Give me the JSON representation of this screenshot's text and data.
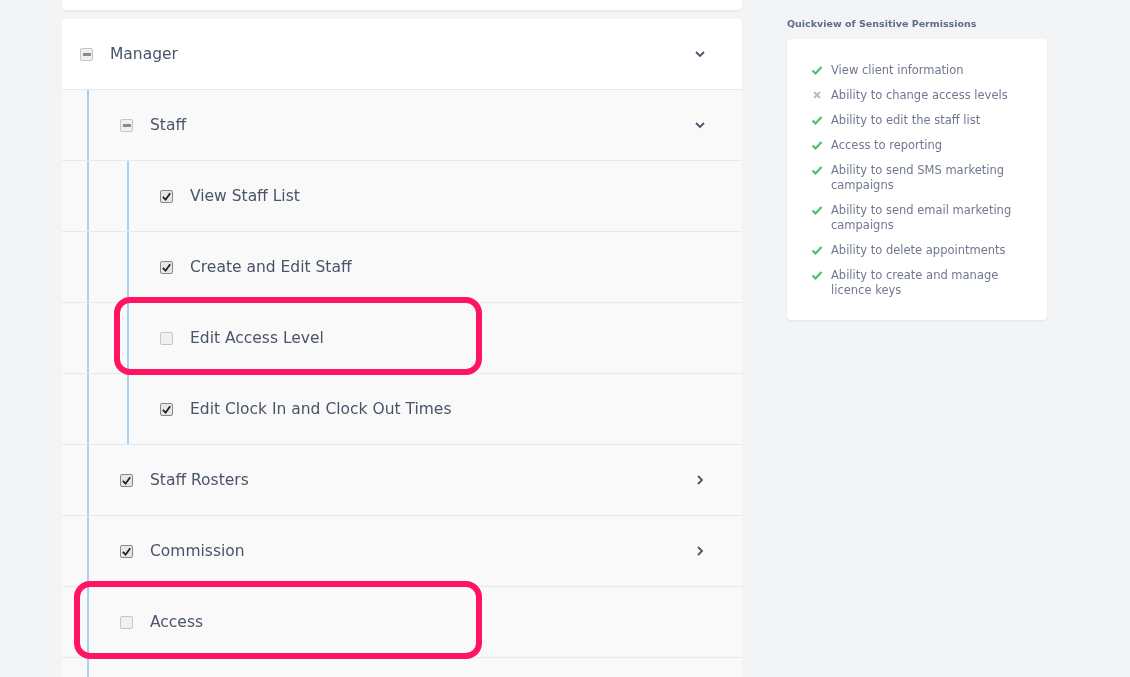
{
  "permissions": [
    {
      "label": "Manager",
      "checked": false,
      "indeterminate": true,
      "expanded": true,
      "highlighted": false,
      "children": [
        {
          "label": "Staff",
          "checked": false,
          "indeterminate": true,
          "expanded": true,
          "highlighted": false,
          "children": [
            {
              "label": "View Staff List",
              "checked": true,
              "indeterminate": false,
              "highlighted": false
            },
            {
              "label": "Create and Edit Staff",
              "checked": true,
              "indeterminate": false,
              "highlighted": false
            },
            {
              "label": "Edit Access Level",
              "checked": false,
              "indeterminate": false,
              "highlighted": true
            },
            {
              "label": "Edit Clock In and Clock Out Times",
              "checked": true,
              "indeterminate": false,
              "highlighted": false
            }
          ]
        },
        {
          "label": "Staff Rosters",
          "checked": true,
          "indeterminate": false,
          "expanded": false,
          "highlighted": false
        },
        {
          "label": "Commission",
          "checked": true,
          "indeterminate": false,
          "expanded": false,
          "highlighted": false
        },
        {
          "label": "Access",
          "checked": false,
          "indeterminate": false,
          "highlighted": true
        }
      ]
    }
  ],
  "quickview": {
    "title": "Quickview of Sensitive Permissions",
    "items": [
      {
        "text": "View client information",
        "allowed": true
      },
      {
        "text": "Ability to change access levels",
        "allowed": false
      },
      {
        "text": "Ability to edit the staff list",
        "allowed": true
      },
      {
        "text": "Access to reporting",
        "allowed": true
      },
      {
        "text": "Ability to send SMS marketing campaigns",
        "allowed": true
      },
      {
        "text": "Ability to send email marketing campaigns",
        "allowed": true
      },
      {
        "text": "Ability to delete appointments",
        "allowed": true
      },
      {
        "text": "Ability to create and manage licence keys",
        "allowed": true
      }
    ]
  }
}
